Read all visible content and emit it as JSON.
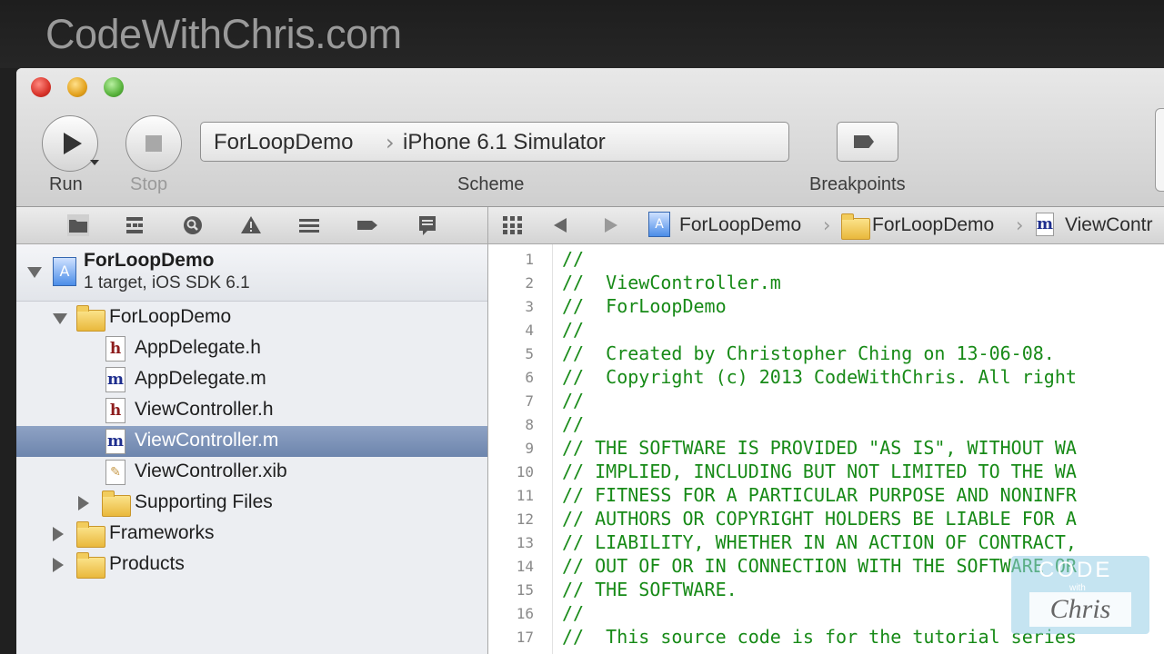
{
  "banner": {
    "title": "CodeWithChris.com"
  },
  "toolbar": {
    "run_label": "Run",
    "stop_label": "Stop",
    "scheme_label": "Scheme",
    "breakpoints_label": "Breakpoints",
    "scheme_target": "ForLoopDemo",
    "scheme_device": "iPhone 6.1 Simulator"
  },
  "navigator_bar": {
    "icons": [
      "folder-icon",
      "hierarchy-icon",
      "search-icon",
      "warning-icon",
      "list-icon",
      "breakpoint-icon",
      "log-icon"
    ]
  },
  "jump_bar": {
    "items": [
      "ForLoopDemo",
      "ForLoopDemo",
      "ViewContr"
    ]
  },
  "navigator": {
    "project": {
      "name": "ForLoopDemo",
      "subtitle": "1 target, iOS SDK 6.1"
    },
    "items": [
      {
        "label": "ForLoopDemo",
        "type": "folder",
        "expanded": true
      },
      {
        "label": "AppDelegate.h",
        "type": "h"
      },
      {
        "label": "AppDelegate.m",
        "type": "m"
      },
      {
        "label": "ViewController.h",
        "type": "h"
      },
      {
        "label": "ViewController.m",
        "type": "m",
        "selected": true
      },
      {
        "label": "ViewController.xib",
        "type": "xib"
      },
      {
        "label": "Supporting Files",
        "type": "folder",
        "expanded": false
      },
      {
        "label": "Frameworks",
        "type": "folder",
        "expanded": false
      },
      {
        "label": "Products",
        "type": "folder",
        "expanded": false
      }
    ],
    "selected_color": "#7890b8"
  },
  "editor": {
    "comment_color": "#178a17",
    "lines": [
      {
        "n": "1",
        "text": "//"
      },
      {
        "n": "2",
        "text": "//  ViewController.m"
      },
      {
        "n": "3",
        "text": "//  ForLoopDemo"
      },
      {
        "n": "4",
        "text": "//"
      },
      {
        "n": "5",
        "text": "//  Created by Christopher Ching on 13-06-08."
      },
      {
        "n": "6",
        "text": "//  Copyright (c) 2013 CodeWithChris. All right"
      },
      {
        "n": "7",
        "text": "//"
      },
      {
        "n": "8",
        "text": "//"
      },
      {
        "n": "9",
        "text": "// THE SOFTWARE IS PROVIDED \"AS IS\", WITHOUT WA"
      },
      {
        "n": "10",
        "text": "// IMPLIED, INCLUDING BUT NOT LIMITED TO THE WA"
      },
      {
        "n": "11",
        "text": "// FITNESS FOR A PARTICULAR PURPOSE AND NONINFR"
      },
      {
        "n": "12",
        "text": "// AUTHORS OR COPYRIGHT HOLDERS BE LIABLE FOR A"
      },
      {
        "n": "13",
        "text": "// LIABILITY, WHETHER IN AN ACTION OF CONTRACT,"
      },
      {
        "n": "14",
        "text": "// OUT OF OR IN CONNECTION WITH THE SOFTWARE OR"
      },
      {
        "n": "15",
        "text": "// THE SOFTWARE."
      },
      {
        "n": "16",
        "text": "//"
      },
      {
        "n": "17",
        "text": "//  This source code is for the tutorial series"
      }
    ]
  },
  "watermark": {
    "top": "CODE",
    "middle": "with",
    "bottom": "Chris"
  }
}
